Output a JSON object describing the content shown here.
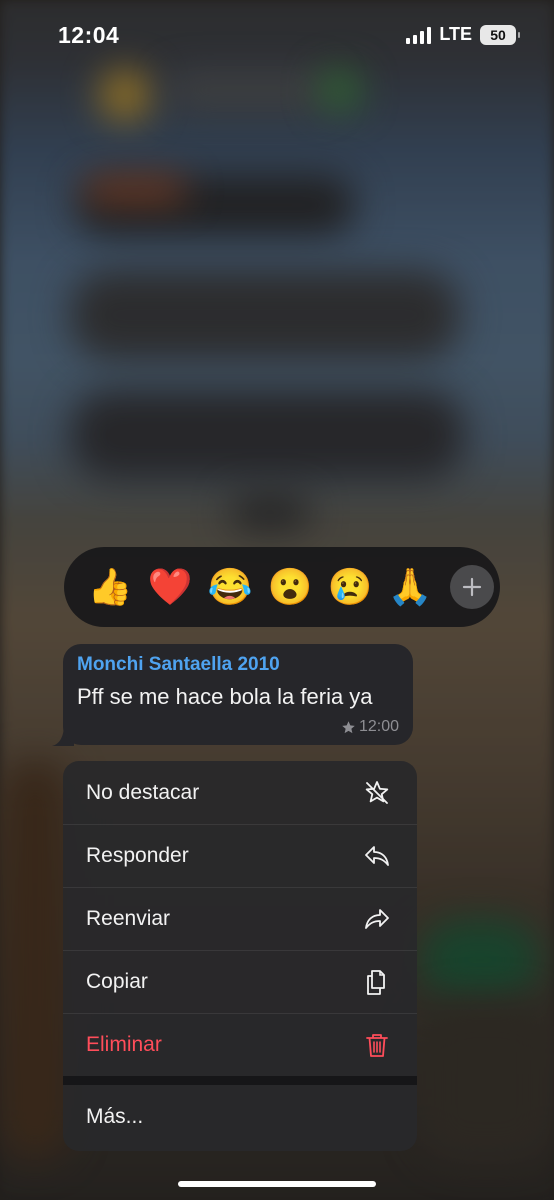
{
  "status_bar": {
    "time": "12:04",
    "network": "LTE",
    "battery": "50"
  },
  "reactions": {
    "emojis": [
      "👍",
      "❤️",
      "😂",
      "😮",
      "😢",
      "🙏"
    ],
    "more_icon": "plus-icon"
  },
  "message": {
    "sender": "Monchi Santaella 2010",
    "text": "Pff se me hace bola la feria ya",
    "time": "12:00",
    "starred": true,
    "sender_color": "#4fa3f0"
  },
  "menu": {
    "items": [
      {
        "label": "No destacar",
        "icon": "unstar-icon"
      },
      {
        "label": "Responder",
        "icon": "reply-icon"
      },
      {
        "label": "Reenviar",
        "icon": "forward-icon"
      },
      {
        "label": "Copiar",
        "icon": "copy-icon"
      },
      {
        "label": "Eliminar",
        "icon": "trash-icon",
        "destructive_color": "#ff4d5a"
      }
    ],
    "more_label": "Más..."
  }
}
